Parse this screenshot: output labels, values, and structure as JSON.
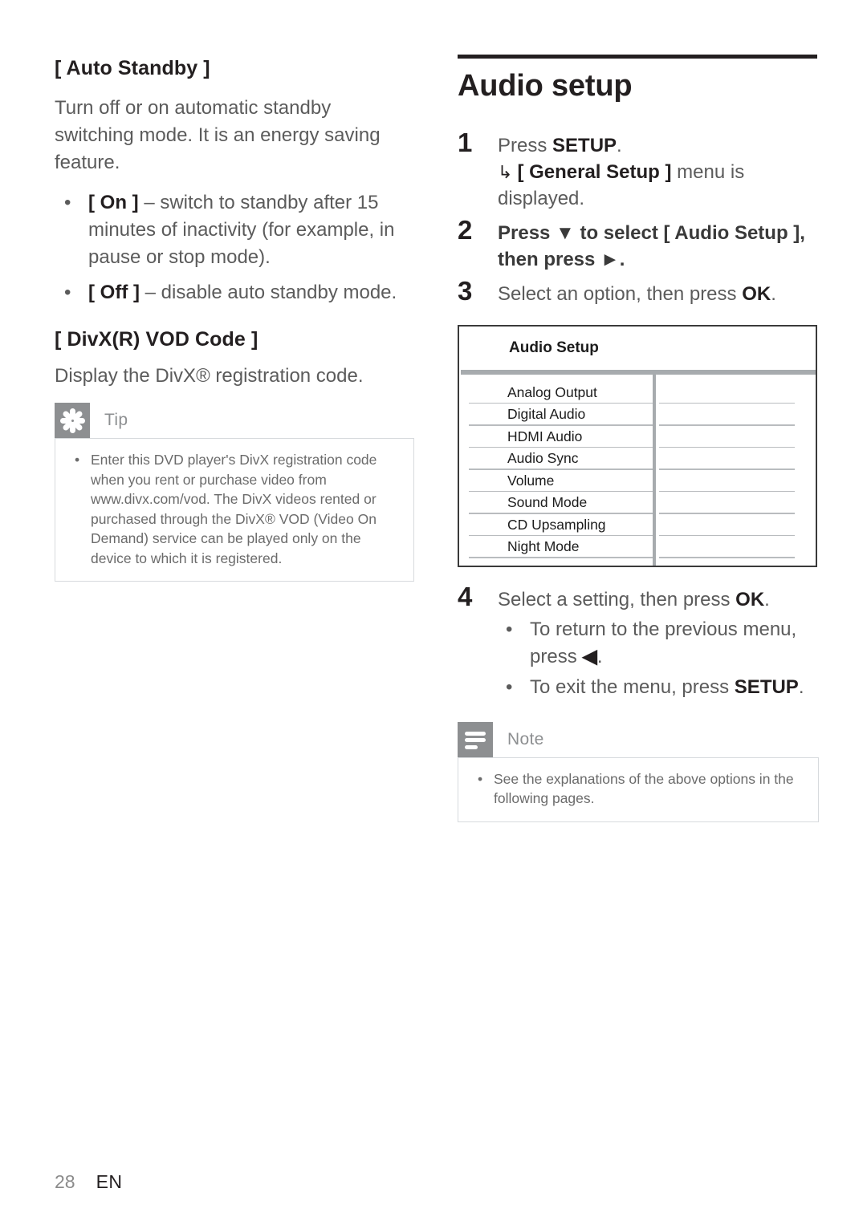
{
  "page": {
    "number": "28",
    "language": "EN"
  },
  "left_column": {
    "section1": {
      "heading": "[ Auto Standby ]",
      "paragraph": "Turn off or on automatic standby switching mode. It is an energy saving feature.",
      "bullets": [
        {
          "term": "[ On ]",
          "text": " – switch to standby after 15 minutes of inactivity (for example, in pause or stop mode)."
        },
        {
          "term": "[ Off ]",
          "text": " – disable auto standby mode."
        }
      ]
    },
    "section2": {
      "heading": "[ DivX(R) VOD Code ]",
      "paragraph": "Display the DivX® registration code."
    },
    "tip_box": {
      "title": "Tip",
      "icon": "asterisk-flower-icon",
      "bullets": [
        "Enter this DVD player's DivX registration code when you rent or purchase video from www.divx.com/vod. The DivX videos rented or purchased through the DivX® VOD (Video On Demand) service can be played only on the device to which it is registered."
      ]
    }
  },
  "right_column": {
    "section_title": "Audio setup",
    "steps": [
      {
        "num": "1",
        "text_before": "Press ",
        "bold": "SETUP",
        "text_after": ".",
        "sub_arrow": "↳",
        "sub_bold": "[ General Setup ]",
        "sub_text": " menu is displayed."
      },
      {
        "num": "2",
        "full_text": "Press ▼ to select [ Audio Setup ], then press ►."
      },
      {
        "num": "3",
        "text_before": "Select an option, then press ",
        "bold": "OK",
        "text_after": "."
      },
      {
        "num": "4",
        "text_before": "Select a setting, then press ",
        "bold": "OK",
        "text_after": ".",
        "bullets": [
          {
            "text_before": "To return to the previous menu, press ",
            "bold": "◀",
            "text_after": "."
          },
          {
            "text_before": "To exit the menu, press ",
            "bold": "SETUP",
            "text_after": "."
          }
        ]
      }
    ],
    "menu_table": {
      "title": "Audio Setup",
      "rows": [
        "Analog Output",
        "Digital Audio",
        "HDMI Audio",
        "Audio Sync",
        "Volume",
        "Sound Mode",
        "CD Upsampling",
        "Night Mode"
      ],
      "values": [
        "",
        "",
        "",
        "",
        "",
        "",
        "",
        ""
      ]
    },
    "note_box": {
      "title": "Note",
      "icon": "three-bars-icon",
      "bullets": [
        "See the explanations of the above options in the following pages."
      ]
    }
  },
  "colors": {
    "rule": "#231f20",
    "callout_gray": "#8d8f91",
    "callout_border": "#d7dadd",
    "table_border": "#3a3a3a",
    "table_divider": "#a7abae",
    "body_text": "#5b5b5b",
    "heading_text": "#231f20"
  }
}
